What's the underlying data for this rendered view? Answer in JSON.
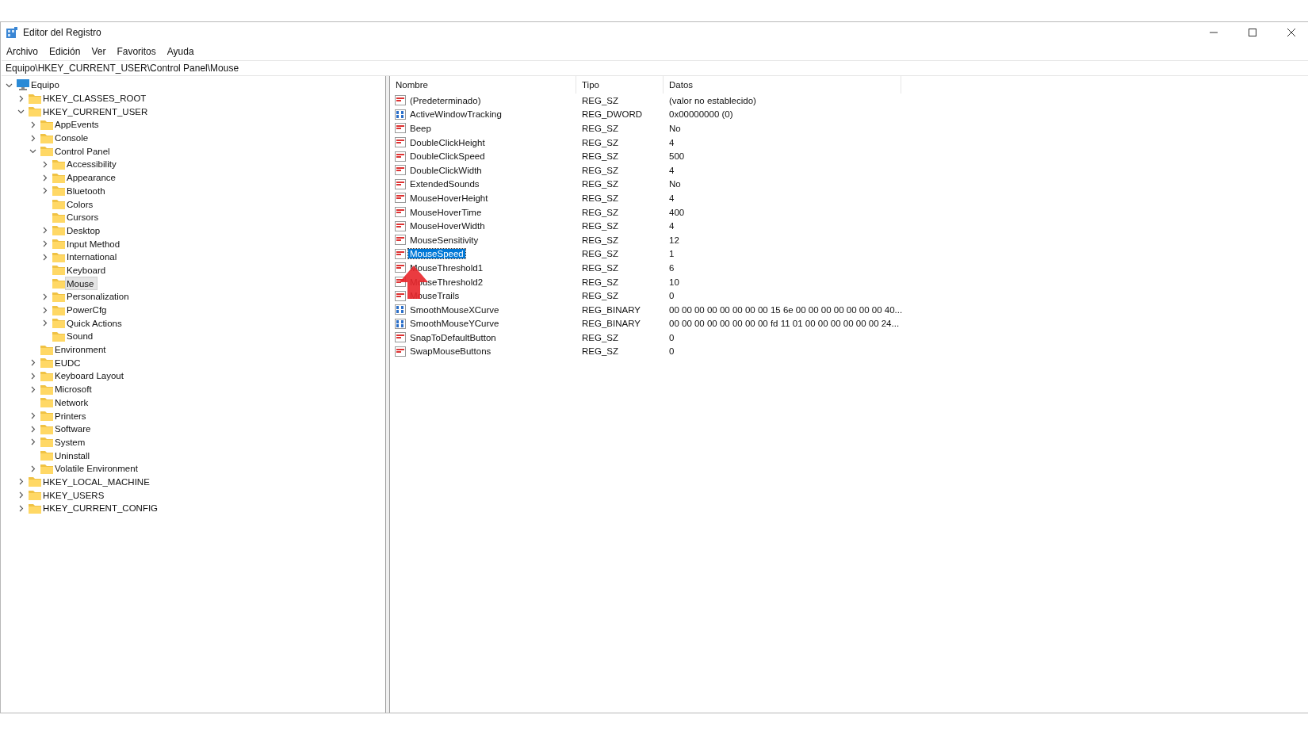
{
  "window": {
    "title": "Editor del Registro"
  },
  "menu": [
    "Archivo",
    "Edición",
    "Ver",
    "Favoritos",
    "Ayuda"
  ],
  "address": "Equipo\\HKEY_CURRENT_USER\\Control Panel\\Mouse",
  "tree": [
    {
      "label": "Equipo",
      "kind": "computer",
      "expanded": true,
      "selected": false,
      "children": [
        {
          "label": "HKEY_CLASSES_ROOT",
          "kind": "folder",
          "expanded": false,
          "selected": false
        },
        {
          "label": "HKEY_CURRENT_USER",
          "kind": "folder",
          "expanded": true,
          "selected": false,
          "children": [
            {
              "label": "AppEvents",
              "kind": "folder",
              "expanded": false,
              "selected": false
            },
            {
              "label": "Console",
              "kind": "folder",
              "expanded": false,
              "selected": false
            },
            {
              "label": "Control Panel",
              "kind": "folder",
              "expanded": true,
              "selected": false,
              "children": [
                {
                  "label": "Accessibility",
                  "kind": "folder",
                  "expanded": false,
                  "selected": false
                },
                {
                  "label": "Appearance",
                  "kind": "folder",
                  "expanded": false,
                  "selected": false
                },
                {
                  "label": "Bluetooth",
                  "kind": "folder",
                  "expanded": false,
                  "selected": false
                },
                {
                  "label": "Colors",
                  "kind": "folder",
                  "selected": false
                },
                {
                  "label": "Cursors",
                  "kind": "folder",
                  "selected": false
                },
                {
                  "label": "Desktop",
                  "kind": "folder",
                  "expanded": false,
                  "selected": false
                },
                {
                  "label": "Input Method",
                  "kind": "folder",
                  "expanded": false,
                  "selected": false
                },
                {
                  "label": "International",
                  "kind": "folder",
                  "expanded": false,
                  "selected": false
                },
                {
                  "label": "Keyboard",
                  "kind": "folder",
                  "selected": false
                },
                {
                  "label": "Mouse",
                  "kind": "folder",
                  "selected": true
                },
                {
                  "label": "Personalization",
                  "kind": "folder",
                  "expanded": false,
                  "selected": false
                },
                {
                  "label": "PowerCfg",
                  "kind": "folder",
                  "expanded": false,
                  "selected": false
                },
                {
                  "label": "Quick Actions",
                  "kind": "folder",
                  "expanded": false,
                  "selected": false
                },
                {
                  "label": "Sound",
                  "kind": "folder",
                  "selected": false
                }
              ]
            },
            {
              "label": "Environment",
              "kind": "folder",
              "selected": false
            },
            {
              "label": "EUDC",
              "kind": "folder",
              "expanded": false,
              "selected": false
            },
            {
              "label": "Keyboard Layout",
              "kind": "folder",
              "expanded": false,
              "selected": false
            },
            {
              "label": "Microsoft",
              "kind": "folder",
              "expanded": false,
              "selected": false
            },
            {
              "label": "Network",
              "kind": "folder",
              "selected": false
            },
            {
              "label": "Printers",
              "kind": "folder",
              "expanded": false,
              "selected": false
            },
            {
              "label": "Software",
              "kind": "folder",
              "expanded": false,
              "selected": false
            },
            {
              "label": "System",
              "kind": "folder",
              "expanded": false,
              "selected": false
            },
            {
              "label": "Uninstall",
              "kind": "folder",
              "selected": false
            },
            {
              "label": "Volatile Environment",
              "kind": "folder",
              "expanded": false,
              "selected": false
            }
          ]
        },
        {
          "label": "HKEY_LOCAL_MACHINE",
          "kind": "folder",
          "expanded": false,
          "selected": false
        },
        {
          "label": "HKEY_USERS",
          "kind": "folder",
          "expanded": false,
          "selected": false
        },
        {
          "label": "HKEY_CURRENT_CONFIG",
          "kind": "folder",
          "expanded": false,
          "selected": false
        }
      ]
    }
  ],
  "table": {
    "columns": [
      "Nombre",
      "Tipo",
      "Datos"
    ],
    "rows": [
      {
        "kind": "string",
        "name": "(Predeterminado)",
        "type": "REG_SZ",
        "data": "(valor no establecido)",
        "selected": false
      },
      {
        "kind": "binary",
        "name": "ActiveWindowTracking",
        "type": "REG_DWORD",
        "data": "0x00000000 (0)",
        "selected": false
      },
      {
        "kind": "string",
        "name": "Beep",
        "type": "REG_SZ",
        "data": "No",
        "selected": false
      },
      {
        "kind": "string",
        "name": "DoubleClickHeight",
        "type": "REG_SZ",
        "data": "4",
        "selected": false
      },
      {
        "kind": "string",
        "name": "DoubleClickSpeed",
        "type": "REG_SZ",
        "data": "500",
        "selected": false
      },
      {
        "kind": "string",
        "name": "DoubleClickWidth",
        "type": "REG_SZ",
        "data": "4",
        "selected": false
      },
      {
        "kind": "string",
        "name": "ExtendedSounds",
        "type": "REG_SZ",
        "data": "No",
        "selected": false
      },
      {
        "kind": "string",
        "name": "MouseHoverHeight",
        "type": "REG_SZ",
        "data": "4",
        "selected": false
      },
      {
        "kind": "string",
        "name": "MouseHoverTime",
        "type": "REG_SZ",
        "data": "400",
        "selected": false
      },
      {
        "kind": "string",
        "name": "MouseHoverWidth",
        "type": "REG_SZ",
        "data": "4",
        "selected": false
      },
      {
        "kind": "string",
        "name": "MouseSensitivity",
        "type": "REG_SZ",
        "data": "12",
        "selected": false
      },
      {
        "kind": "string",
        "name": "MouseSpeed",
        "type": "REG_SZ",
        "data": "1",
        "selected": true
      },
      {
        "kind": "string",
        "name": "MouseThreshold1",
        "type": "REG_SZ",
        "data": "6",
        "selected": false
      },
      {
        "kind": "string",
        "name": "MouseThreshold2",
        "type": "REG_SZ",
        "data": "10",
        "selected": false
      },
      {
        "kind": "string",
        "name": "MouseTrails",
        "type": "REG_SZ",
        "data": "0",
        "selected": false
      },
      {
        "kind": "binary",
        "name": "SmoothMouseXCurve",
        "type": "REG_BINARY",
        "data": "00 00 00 00 00 00 00 00 15 6e 00 00 00 00 00 00 00 40...",
        "selected": false
      },
      {
        "kind": "binary",
        "name": "SmoothMouseYCurve",
        "type": "REG_BINARY",
        "data": "00 00 00 00 00 00 00 00 fd 11 01 00 00 00 00 00 00 24...",
        "selected": false
      },
      {
        "kind": "string",
        "name": "SnapToDefaultButton",
        "type": "REG_SZ",
        "data": "0",
        "selected": false
      },
      {
        "kind": "string",
        "name": "SwapMouseButtons",
        "type": "REG_SZ",
        "data": "0",
        "selected": false
      }
    ]
  }
}
